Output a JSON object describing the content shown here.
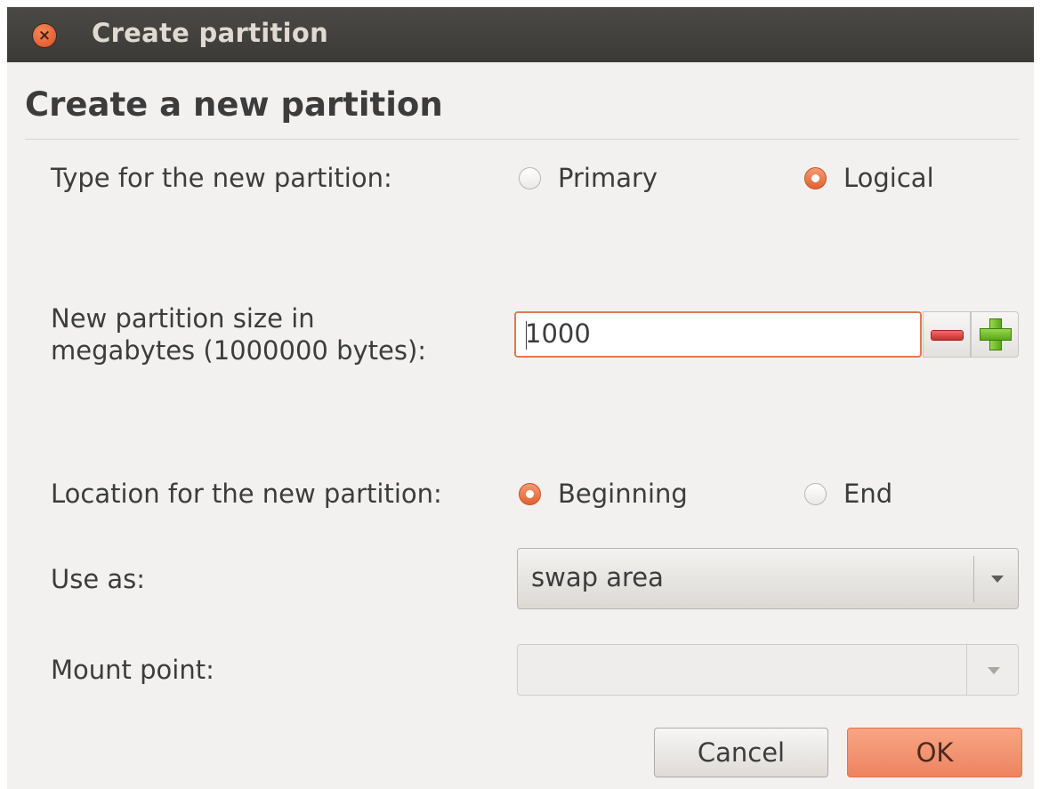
{
  "window": {
    "title": "Create partition",
    "close_glyph": "×"
  },
  "heading": "Create a new partition",
  "type": {
    "label": "Type for the new partition:",
    "options": [
      {
        "label": "Primary",
        "checked": false
      },
      {
        "label": "Logical",
        "checked": true
      }
    ]
  },
  "size": {
    "label_line1": "New partition size in",
    "label_line2": "megabytes (1000000 bytes):",
    "value": "1000",
    "minus_icon": "minus-icon",
    "plus_icon": "plus-icon"
  },
  "location": {
    "label": "Location for the new partition:",
    "options": [
      {
        "label": "Beginning",
        "checked": true
      },
      {
        "label": "End",
        "checked": false
      }
    ]
  },
  "use_as": {
    "label": "Use as:",
    "selected": "swap area"
  },
  "mount_point": {
    "label": "Mount point:",
    "value": ""
  },
  "buttons": {
    "cancel": "Cancel",
    "ok": "OK"
  },
  "colors": {
    "accent": "#e2622f",
    "titlebar": "#3c3b37",
    "window_bg": "#f2f1f0"
  }
}
